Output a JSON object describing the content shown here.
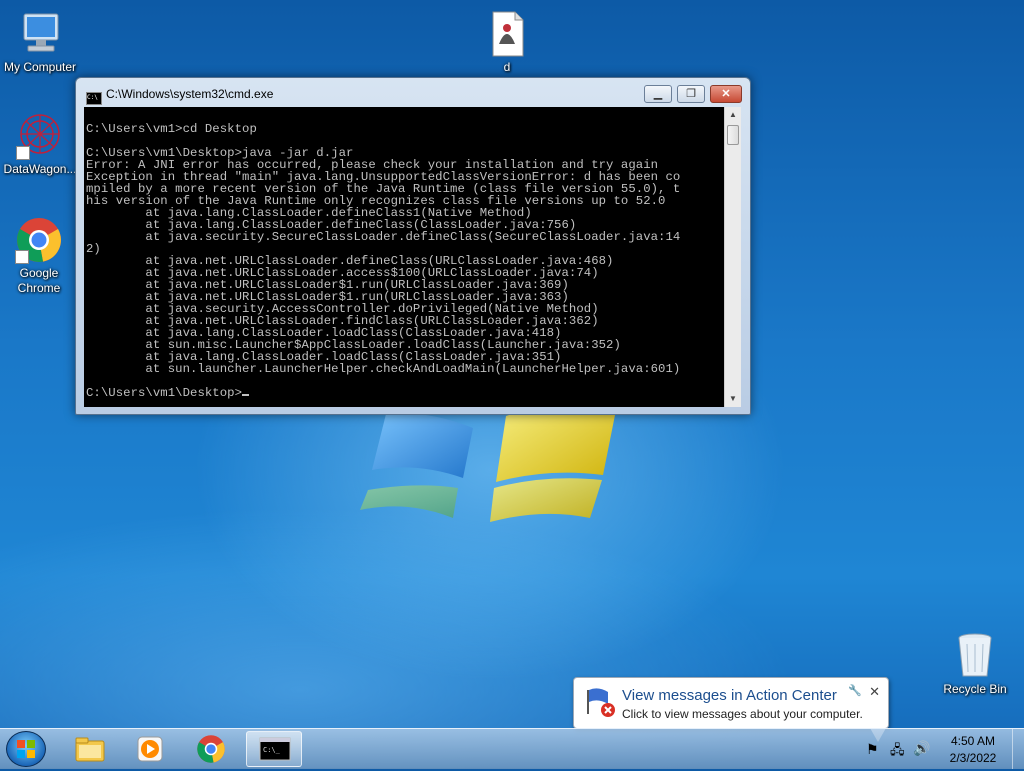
{
  "desktop": {
    "icons": [
      {
        "label": "My Computer",
        "icon": "computer-icon"
      },
      {
        "label": "DataWagon...",
        "icon": "datawagon-icon"
      },
      {
        "label": "Google Chrome",
        "icon": "chrome-icon"
      },
      {
        "label": "d",
        "icon": "java-file-icon"
      },
      {
        "label": "Recycle Bin",
        "icon": "recycle-bin-icon"
      }
    ]
  },
  "cmd": {
    "title": "C:\\Windows\\system32\\cmd.exe",
    "icon_glyph": "C:\\",
    "lines": [
      "",
      "C:\\Users\\vm1>cd Desktop",
      "",
      "C:\\Users\\vm1\\Desktop>java -jar d.jar",
      "Error: A JNI error has occurred, please check your installation and try again",
      "Exception in thread \"main\" java.lang.UnsupportedClassVersionError: d has been co",
      "mpiled by a more recent version of the Java Runtime (class file version 55.0), t",
      "his version of the Java Runtime only recognizes class file versions up to 52.0",
      "        at java.lang.ClassLoader.defineClass1(Native Method)",
      "        at java.lang.ClassLoader.defineClass(ClassLoader.java:756)",
      "        at java.security.SecureClassLoader.defineClass(SecureClassLoader.java:14",
      "2)",
      "        at java.net.URLClassLoader.defineClass(URLClassLoader.java:468)",
      "        at java.net.URLClassLoader.access$100(URLClassLoader.java:74)",
      "        at java.net.URLClassLoader$1.run(URLClassLoader.java:369)",
      "        at java.net.URLClassLoader$1.run(URLClassLoader.java:363)",
      "        at java.security.AccessController.doPrivileged(Native Method)",
      "        at java.net.URLClassLoader.findClass(URLClassLoader.java:362)",
      "        at java.lang.ClassLoader.loadClass(ClassLoader.java:418)",
      "        at sun.misc.Launcher$AppClassLoader.loadClass(Launcher.java:352)",
      "        at java.lang.ClassLoader.loadClass(ClassLoader.java:351)",
      "        at sun.launcher.LauncherHelper.checkAndLoadMain(LauncherHelper.java:601)",
      "",
      "C:\\Users\\vm1\\Desktop>"
    ]
  },
  "balloon": {
    "title": "View messages in Action Center",
    "message": "Click to view messages about your computer.",
    "icon": "action-center-flag-icon"
  },
  "taskbar": {
    "items": [
      "start-orb-icon",
      "explorer-icon",
      "media-player-icon",
      "chrome-icon",
      "cmd-icon"
    ],
    "clock_time": "4:50 AM",
    "clock_date": "2/3/2022"
  },
  "colors": {
    "console_bg": "#000000",
    "console_fg": "#c0c0c0",
    "desktop": "#1a78c8"
  }
}
